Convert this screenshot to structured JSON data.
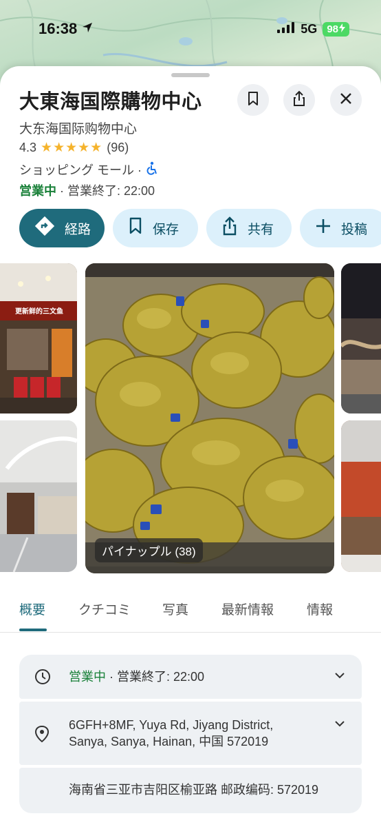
{
  "status": {
    "time": "16:38",
    "network": "5G",
    "battery": "98"
  },
  "place": {
    "title": "大東海国際購物中心",
    "subtitle": "大东海国际购物中心",
    "rating": "4.3",
    "stars": "★★★★★",
    "review_count": "(96)",
    "category": "ショッピング モール ·",
    "open_status": "営業中",
    "hours_text": " · 営業終了: 22:00"
  },
  "actions": {
    "directions": "経路",
    "save": "保存",
    "share": "共有",
    "post": "投稿"
  },
  "photos": {
    "main_caption": "パイナップル (38)",
    "side_sign_text": "更新鲜的三文鱼"
  },
  "tabs": [
    {
      "label": "概要"
    },
    {
      "label": "クチコミ"
    },
    {
      "label": "写真"
    },
    {
      "label": "最新情報"
    },
    {
      "label": "情報"
    }
  ],
  "info": {
    "hours_open": "営業中",
    "hours_rest": " · 営業終了: 22:00",
    "address_line1": "6GFH+8MF, Yuya Rd, Jiyang District,",
    "address_line2": "Sanya, Sanya, Hainan, 中国 572019",
    "address_local": "海南省三亚市吉阳区榆亚路 邮政编码: 572019"
  },
  "colors": {
    "accent": "#1f6b7c",
    "open_green": "#188038",
    "star": "#f5b32c",
    "pill_bg": "#dcf0fb"
  }
}
